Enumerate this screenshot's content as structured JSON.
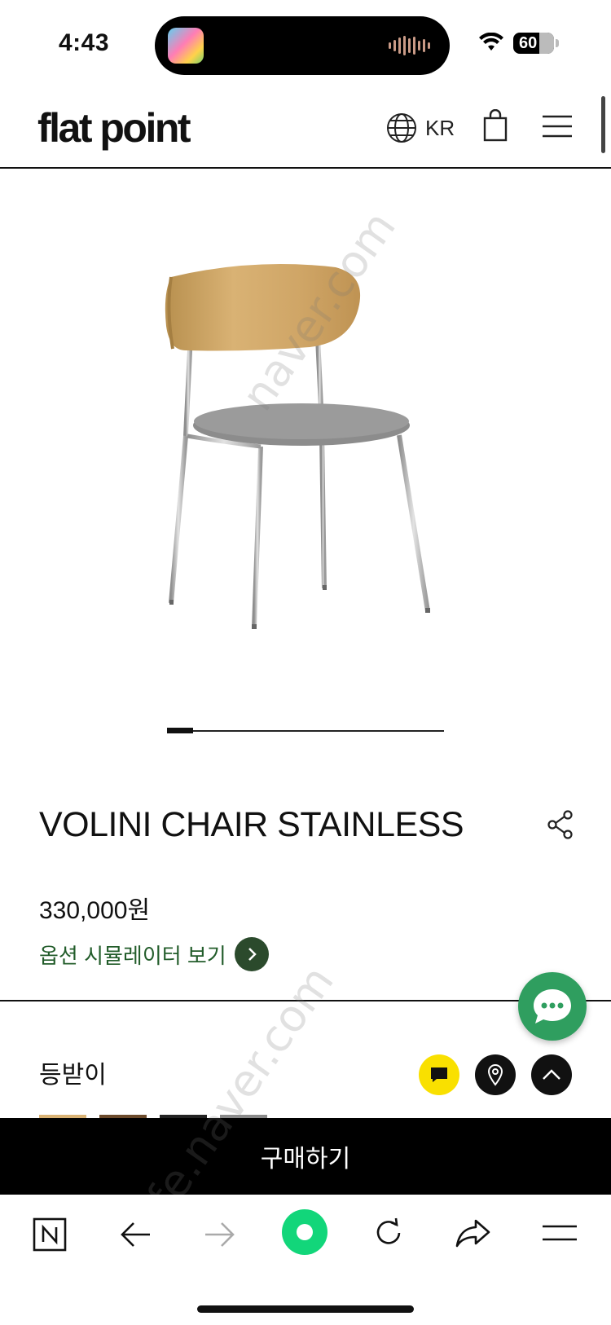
{
  "status_bar": {
    "time": "4:43",
    "battery": "60"
  },
  "header": {
    "logo": "flat point",
    "language": "KR",
    "icons": [
      "globe-icon",
      "shopping-bag-icon",
      "hamburger-menu-icon"
    ]
  },
  "watermarks": [
    "naver.com",
    "cafe.naver.com"
  ],
  "product": {
    "name": "VOLINI CHAIR STAINLESS",
    "price": "330,000원",
    "simulator_link": "옵션 시뮬레이터 보기",
    "option_label": "등받이",
    "carousel": {
      "current": 1,
      "total": 10
    }
  },
  "actions": {
    "buy_label": "구매하기"
  },
  "colors": {
    "accent_green": "#2f9e5f",
    "link_green": "#225c2a",
    "kakao_yellow": "#f9e000",
    "bar_black": "#000000"
  },
  "toolbar": {
    "items": [
      "naver-n-icon",
      "back-arrow-icon",
      "forward-arrow-icon",
      "green-dot-icon",
      "refresh-icon",
      "share-arrow-icon",
      "menu-icon"
    ]
  }
}
